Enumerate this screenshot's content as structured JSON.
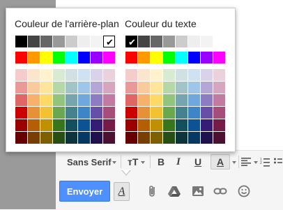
{
  "popup": {
    "bg_title": "Couleur de l'arrière-plan",
    "text_title": "Couleur du texte",
    "grays": [
      "#000000",
      "#444444",
      "#666666",
      "#999999",
      "#cccccc",
      "#eeeeee",
      "#f3f3f3",
      "#ffffff"
    ],
    "brights": [
      "#ff0000",
      "#ff9900",
      "#ffff00",
      "#00ff00",
      "#00ffff",
      "#0000ff",
      "#9900ff",
      "#ff00ff"
    ],
    "shades": [
      [
        "#f4cccc",
        "#fce5cd",
        "#fff2cc",
        "#d9ead3",
        "#d0e0e3",
        "#cfe2f3",
        "#d9d2e9",
        "#ead1dc"
      ],
      [
        "#ea9999",
        "#f9cb9c",
        "#ffe599",
        "#b6d7a8",
        "#a2c4c9",
        "#9fc5e8",
        "#b4a7d6",
        "#d5a6bd"
      ],
      [
        "#e06666",
        "#f6b26b",
        "#ffd966",
        "#93c47d",
        "#76a5af",
        "#6fa8dc",
        "#8e7cc3",
        "#c27ba0"
      ],
      [
        "#cc0000",
        "#e69138",
        "#f1c232",
        "#6aa84f",
        "#45818e",
        "#3d85c6",
        "#674ea7",
        "#a64d79"
      ],
      [
        "#990000",
        "#b45f06",
        "#bf9000",
        "#38761d",
        "#134f5c",
        "#0b5394",
        "#351c75",
        "#741b47"
      ],
      [
        "#660000",
        "#783f04",
        "#7f6000",
        "#274e13",
        "#0c343d",
        "#073763",
        "#20124d",
        "#4c1130"
      ]
    ],
    "check_glyph": "✔"
  },
  "toolbar": {
    "font_label": "Sans Serif",
    "size_label": "тT",
    "bold_label": "B",
    "italic_label": "I",
    "underline_label": "U",
    "text_color_label": "A"
  },
  "sendbar": {
    "send_label": "Envoyer",
    "format_label": "A"
  }
}
